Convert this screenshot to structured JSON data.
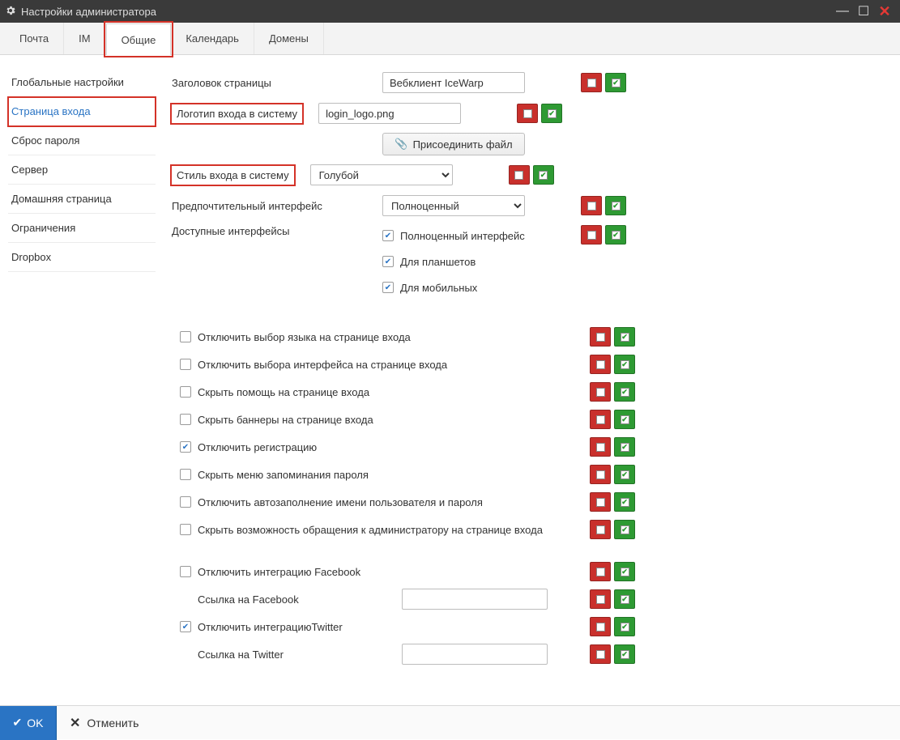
{
  "window": {
    "title": "Настройки администратора"
  },
  "tabs": [
    {
      "label": "Почта"
    },
    {
      "label": "IM"
    },
    {
      "label": "Общие",
      "active": true
    },
    {
      "label": "Календарь"
    },
    {
      "label": "Домены"
    }
  ],
  "sidebar": [
    {
      "label": "Глобальные настройки"
    },
    {
      "label": "Страница входа",
      "active": true
    },
    {
      "label": "Сброс пароля"
    },
    {
      "label": "Сервер"
    },
    {
      "label": "Домашняя страница"
    },
    {
      "label": "Ограничения"
    },
    {
      "label": "Dropbox"
    }
  ],
  "fields": {
    "page_title_label": "Заголовок страницы",
    "page_title_value": "Вебклиент IceWarp",
    "logo_label": "Логотип входа в систему",
    "logo_value": "login_logo.png",
    "attach_label": "Присоединить файл",
    "style_label": "Стиль входа в систему",
    "style_value": "Голубой",
    "interface_label": "Предпочтительный интерфейс",
    "interface_value": "Полноценный",
    "available_label": "Доступные интерфейсы",
    "avail_full": "Полноценный интерфейс",
    "avail_tablet": "Для планшетов",
    "avail_mobile": "Для мобильных"
  },
  "options": [
    {
      "label": "Отключить выбор языка на странице входа",
      "checked": false
    },
    {
      "label": "Отключить выбора интерфейса на странице входа",
      "checked": false
    },
    {
      "label": "Скрыть помощь на странице входа",
      "checked": false
    },
    {
      "label": "Скрыть баннеры на странице входа",
      "checked": false
    },
    {
      "label": "Отключить регистрацию",
      "checked": true
    },
    {
      "label": "Скрыть меню запоминания пароля",
      "checked": false
    },
    {
      "label": "Отключить автозаполнение имени пользователя и пароля",
      "checked": false
    },
    {
      "label": "Скрыть возможность обращения к администратору на странице входа",
      "checked": false
    }
  ],
  "social": {
    "disable_fb": "Отключить интеграцию Facebook",
    "fb_link_label": "Ссылка на Facebook",
    "fb_link_value": "",
    "disable_fb_checked": false,
    "disable_tw": "Отключить интеграциюTwitter",
    "tw_link_label": "Ссылка на Twitter",
    "tw_link_value": "",
    "disable_tw_checked": true
  },
  "footer": {
    "ok": "OK",
    "cancel": "Отменить"
  }
}
